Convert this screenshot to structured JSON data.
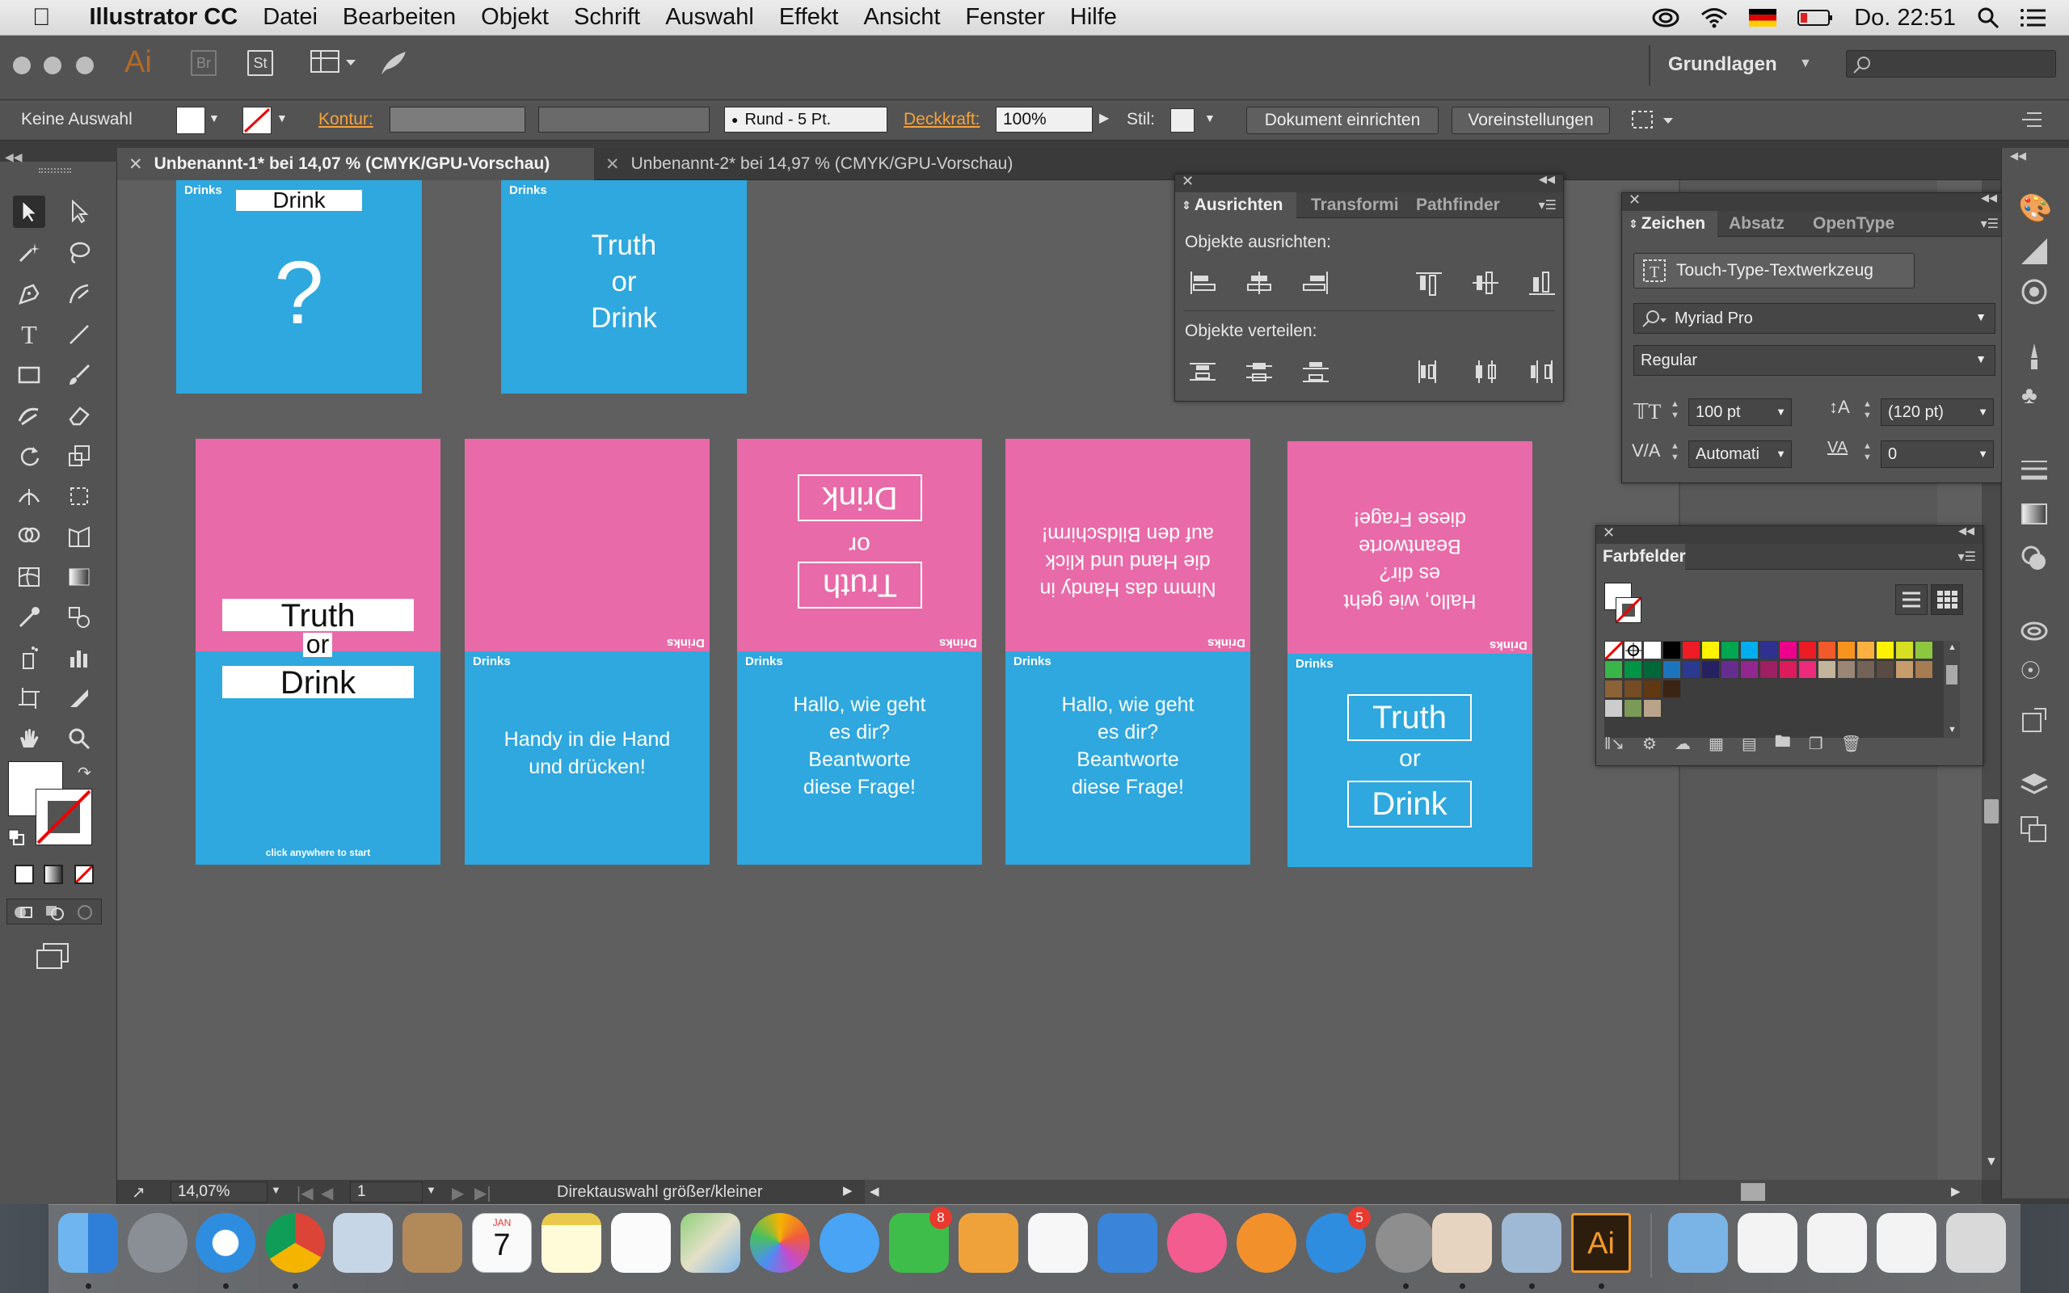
{
  "menubar": {
    "app_name": "Illustrator CC",
    "items": [
      "Datei",
      "Bearbeiten",
      "Objekt",
      "Schrift",
      "Auswahl",
      "Effekt",
      "Ansicht",
      "Fenster",
      "Hilfe"
    ],
    "clock": "Do. 22:51"
  },
  "appbar": {
    "ai_logo": "Ai",
    "br": "Br",
    "st": "St",
    "workspace": "Grundlagen"
  },
  "control_bar": {
    "selection": "Keine Auswahl",
    "kontur_label": "Kontur:",
    "brush": "Rund - 5 Pt.",
    "opacity_label": "Deckkraft:",
    "opacity_value": "100%",
    "style_label": "Stil:",
    "doc_setup": "Dokument einrichten",
    "prefs": "Voreinstellungen"
  },
  "tabs": [
    {
      "label": "Unbenannt-1* bei 14,07 % (CMYK/GPU-Vorschau)"
    },
    {
      "label": "Unbenannt-2* bei 14,97 % (CMYK/GPU-Vorschau)"
    }
  ],
  "artboards": {
    "ab1": {
      "brand": "Drinks",
      "drink": "Drink",
      "question": "?"
    },
    "ab2": {
      "brand": "Drinks",
      "text": [
        "Truth",
        "or",
        "Drink"
      ]
    },
    "ab3": {
      "truth": "Truth",
      "or": "or",
      "drink": "Drink",
      "footer": "click anywhere to start"
    },
    "ab4": {
      "brand_top": "Drinks",
      "brand": "Drinks",
      "text": [
        "Handy in die Hand",
        "und drücken!"
      ]
    },
    "ab5": {
      "flipped": [
        "Truth",
        "or",
        "Drink"
      ],
      "brand_top": "Drinks",
      "brand": "Drinks",
      "text": [
        "Hallo, wie geht",
        "es dir?",
        "Beantworte",
        "diese Frage!"
      ]
    },
    "ab6": {
      "flipped": [
        "Nimm das Handy in",
        "die Hand und klick",
        "auf den Bildschirm!"
      ],
      "brand_top": "Drinks",
      "brand": "Drinks",
      "text": [
        "Hallo, wie geht",
        "es dir?",
        "Beantworte",
        "diese Frage!"
      ]
    },
    "ab7": {
      "flipped": [
        "Hallo, wie geht",
        "es dir?",
        "Beantworte",
        "diese Frage!"
      ],
      "brand_top": "Drinks",
      "brand": "Drinks",
      "truth": "Truth",
      "or": "or",
      "drink": "Drink"
    }
  },
  "align_panel": {
    "tabs": [
      "Ausrichten",
      "Transformi",
      "Pathfinder"
    ],
    "align_label": "Objekte ausrichten:",
    "distribute_label": "Objekte verteilen:"
  },
  "char_panel": {
    "tabs": [
      "Zeichen",
      "Absatz",
      "OpenType"
    ],
    "touch_tool": "Touch-Type-Textwerkzeug",
    "font": "Myriad Pro",
    "style": "Regular",
    "size": "100 pt",
    "leading": "(120 pt)",
    "kerning": "Automati",
    "tracking": "0"
  },
  "swatch_panel": {
    "title": "Farbfelder",
    "colors": [
      "#ffffff",
      "#000000",
      "#ee1c25",
      "#fff200",
      "#00a650",
      "#00aeef",
      "#2e3192",
      "#ec008c",
      "#ed1c24",
      "#f15a29",
      "#f7941d",
      "#fbb040",
      "#fff200",
      "#d7df23",
      "#8dc63f",
      "#39b54a",
      "#009444",
      "#006838",
      "#1c75bc",
      "#2b3990",
      "#262262",
      "#662d91",
      "#92278f",
      "#9e1f63",
      "#da1c5c",
      "#ee2a7b",
      "#c2b59b",
      "#998675",
      "#736357",
      "#594a42",
      "#c69c6d",
      "#a67c52",
      "#8c6239",
      "#754c24",
      "#603913",
      "#3c2415"
    ]
  },
  "status": {
    "zoom": "14,07%",
    "page": "1",
    "info": "Direktauswahl größer/kleiner"
  },
  "dock": {
    "calendar_month": "JAN",
    "calendar_day": "7",
    "facetime_badge": "8",
    "appstore_badge": "5",
    "ai_label": "Ai"
  },
  "colors": {
    "pink": "#e96aa8",
    "blue": "#2ea8de",
    "ai_orange": "#f6a23c",
    "panel_bg": "#535353"
  }
}
